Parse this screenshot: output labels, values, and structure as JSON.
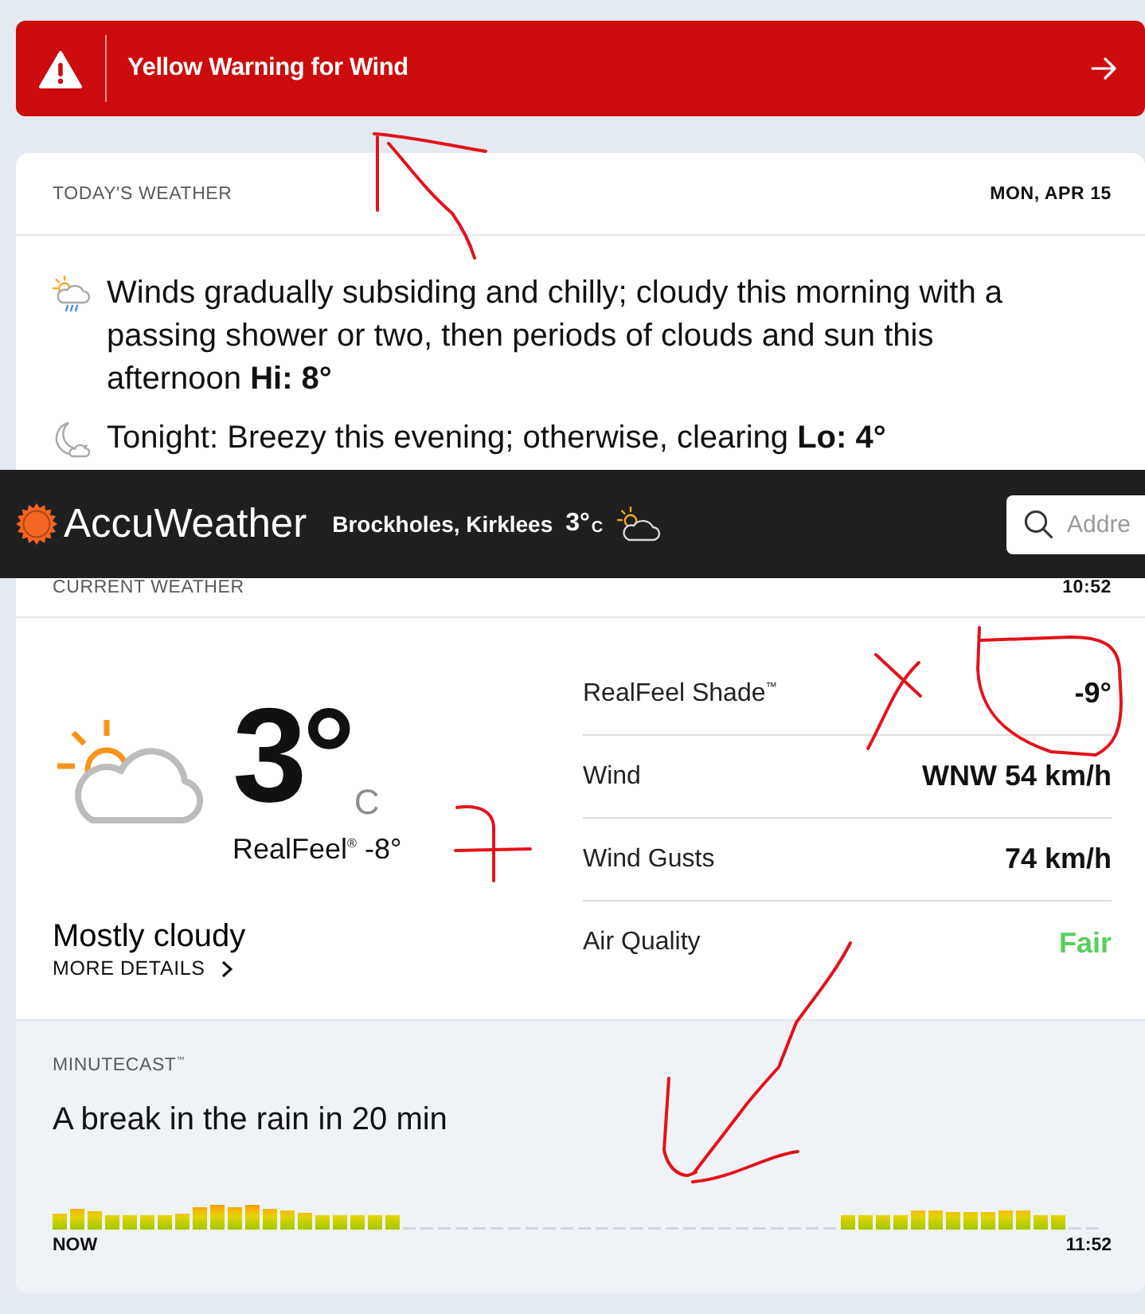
{
  "alert": {
    "title": "Yellow Warning for Wind"
  },
  "todays_weather": {
    "heading": "TODAY'S WEATHER",
    "date": "MON, APR 15",
    "forecasts": [
      {
        "kind": "day",
        "text": "Winds gradually subsiding and chilly; cloudy this morning with a passing shower or two, then periods of clouds and sun this afternoon **Hi: 8°**"
      },
      {
        "kind": "night",
        "text": "Tonight: Breezy this evening; otherwise, clearing **Lo: 4°**"
      }
    ]
  },
  "header": {
    "brand": "AccuWeather",
    "location": "Brockholes, Kirklees",
    "temperature": "3°",
    "unit": "C",
    "search": {
      "placeholder": "Addre"
    }
  },
  "current_weather": {
    "heading": "CURRENT WEATHER",
    "time": "10:52",
    "temperature": "3°",
    "unit": "C",
    "realfeel": "RealFeel$^{®}$ -8°",
    "condition": "Mostly cloudy",
    "more_details": "MORE DETAILS",
    "details": [
      {
        "label": "RealFeel Shade$^{™}$",
        "value": "-9°",
        "color": "#111111"
      },
      {
        "label": "Wind",
        "value": "WNW 54 km/h",
        "color": "#111111"
      },
      {
        "label": "Wind Gusts",
        "value": "74 km/h",
        "color": "#111111"
      },
      {
        "label": "Air Quality",
        "value": "Fair",
        "color": "#56cf5c"
      }
    ]
  },
  "minutecast": {
    "heading": "MINUTECAST$^{™}$",
    "summary": "A break in the rain in 20 min",
    "start_label": "NOW",
    "end_label": "11:52"
  }
}
